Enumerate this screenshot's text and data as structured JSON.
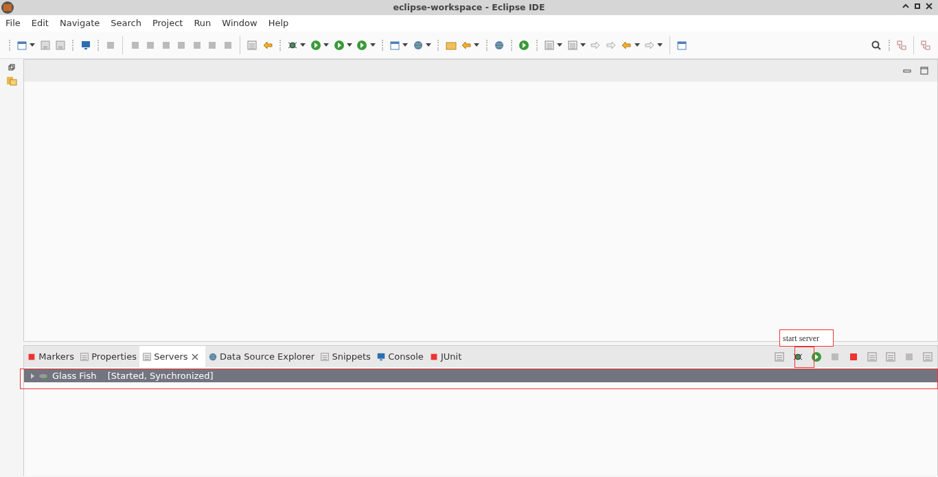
{
  "window": {
    "title": "eclipse-workspace - Eclipse IDE"
  },
  "menu": [
    "File",
    "Edit",
    "Navigate",
    "Search",
    "Project",
    "Run",
    "Window",
    "Help"
  ],
  "panel_tabs": [
    {
      "label": "Markers",
      "selected": false,
      "closable": false
    },
    {
      "label": "Properties",
      "selected": false,
      "closable": false
    },
    {
      "label": "Servers",
      "selected": true,
      "closable": true
    },
    {
      "label": "Data Source Explorer",
      "selected": false,
      "closable": false
    },
    {
      "label": "Snippets",
      "selected": false,
      "closable": false
    },
    {
      "label": "Console",
      "selected": false,
      "closable": false
    },
    {
      "label": "JUnit",
      "selected": false,
      "closable": false
    }
  ],
  "servers": [
    {
      "name": "Glass Fish",
      "status": "[Started, Synchronized]",
      "selected": true,
      "expanded": false
    }
  ],
  "tooltip": {
    "text": "start server"
  }
}
